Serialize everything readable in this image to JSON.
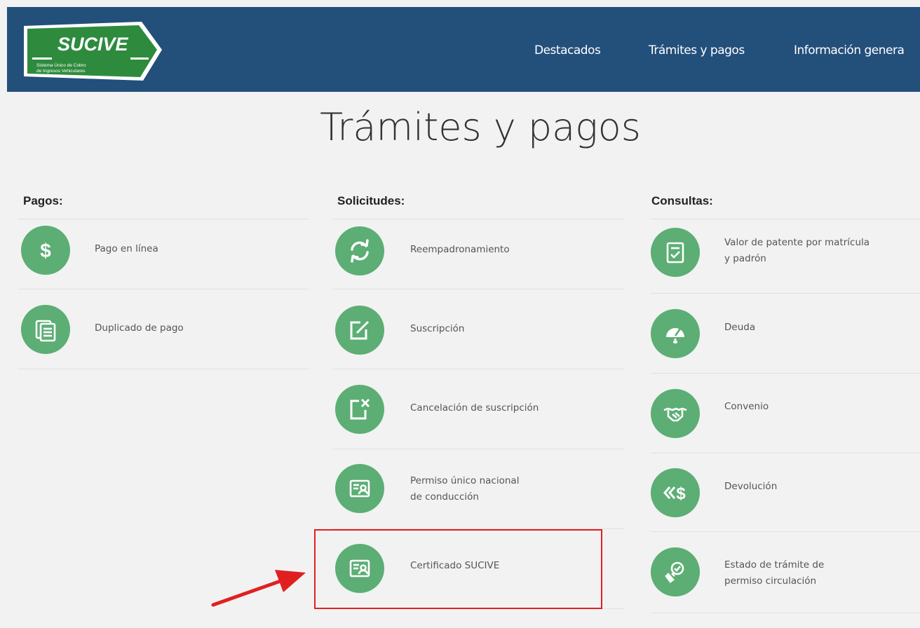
{
  "header": {
    "logo": {
      "brand": "SUCIVE",
      "tagline_line1": "Sistema Único de Cobro",
      "tagline_line2": "de Ingresos Vehiculares"
    },
    "nav": [
      "Destacados",
      "Trámites y pagos",
      "Información genera"
    ]
  },
  "page_title": "Trámites y pagos",
  "columns": [
    {
      "heading": "Pagos:",
      "items": [
        {
          "label_line1": "Pago en línea",
          "label_line2": "",
          "icon": "dollar-icon"
        },
        {
          "label_line1": "Duplicado de pago",
          "label_line2": "",
          "icon": "documents-icon"
        }
      ]
    },
    {
      "heading": "Solicitudes:",
      "items": [
        {
          "label_line1": "Reempadronamiento",
          "label_line2": "",
          "icon": "refresh-icon"
        },
        {
          "label_line1": "Suscripción",
          "label_line2": "",
          "icon": "edit-icon"
        },
        {
          "label_line1": "Cancelación de suscripción",
          "label_line2": "",
          "icon": "cancel-document-icon"
        },
        {
          "label_line1": "Permiso único nacional",
          "label_line2": "de conducción",
          "icon": "license-card-icon"
        },
        {
          "label_line1": "Certificado SUCIVE",
          "label_line2": "",
          "icon": "certificate-card-icon"
        }
      ]
    },
    {
      "heading": "Consultas:",
      "items": [
        {
          "label_line1": "Valor de patente por matrícula",
          "label_line2": "y padrón",
          "icon": "checklist-icon"
        },
        {
          "label_line1": "Deuda",
          "label_line2": "",
          "icon": "gauge-icon"
        },
        {
          "label_line1": "Convenio",
          "label_line2": "",
          "icon": "handshake-icon"
        },
        {
          "label_line1": "Devolución",
          "label_line2": "",
          "icon": "refund-icon"
        },
        {
          "label_line1": "Estado de trámite de",
          "label_line2": "permiso circulación",
          "icon": "status-check-icon"
        }
      ]
    }
  ],
  "colors": {
    "header_bg": "#234f7b",
    "logo_green": "#2e8b3e",
    "icon_green": "#5cae74",
    "highlight_red": "#e02020",
    "page_bg": "#f2f2f2"
  }
}
